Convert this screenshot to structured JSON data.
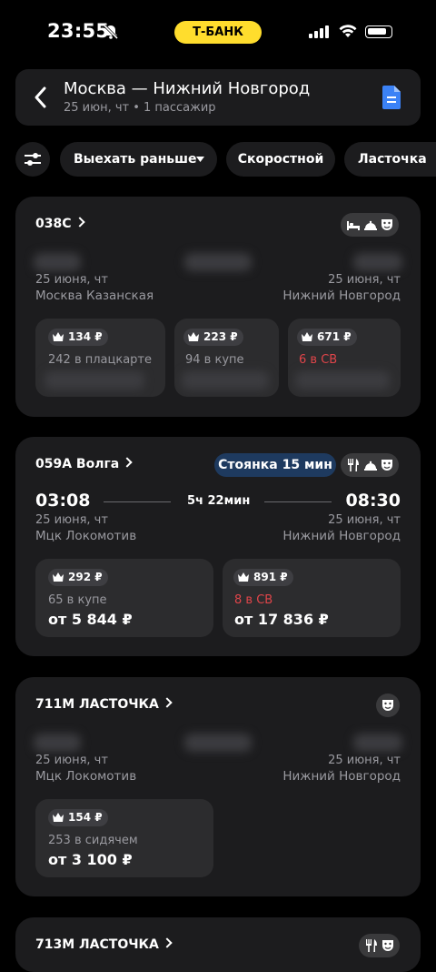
{
  "status_bar": {
    "time": "23:55",
    "bank": "Т-БАНК"
  },
  "header": {
    "route": "Москва — Нижний Новгород",
    "subtitle": "25 июн, чт • 1 пассажир"
  },
  "filters": [
    "Выехать раньше",
    "Скоростной",
    "Ласточка"
  ],
  "trains": [
    {
      "number": "038С",
      "dep_date": "25 июня, чт",
      "arr_date": "25 июня, чт",
      "dep_station": "Москва Казанская",
      "arr_station": "Нижний Новгород",
      "fares": [
        {
          "bonus": "134 ₽",
          "seats": "242 в плацкарте"
        },
        {
          "bonus": "223 ₽",
          "seats": "94 в купе"
        },
        {
          "bonus": "671 ₽",
          "seats": "6 в СВ"
        }
      ]
    },
    {
      "number": "059А Волга",
      "stop": "Стоянка 15 мин",
      "dep_time": "03:08",
      "duration": "5ч 22мин",
      "arr_time": "08:30",
      "dep_date": "25 июня, чт",
      "arr_date": "25 июня, чт",
      "dep_station": "Мцк Локомотив",
      "arr_station": "Нижний Новгород",
      "fares": [
        {
          "bonus": "292 ₽",
          "seats": "65 в купе",
          "price": "от 5 844 ₽"
        },
        {
          "bonus": "891 ₽",
          "seats": "8 в СВ",
          "price": "от 17 836 ₽"
        }
      ]
    },
    {
      "number": "711М ЛАСТОЧКА",
      "dep_date": "25 июня, чт",
      "arr_date": "25 июня, чт",
      "dep_station": "Мцк Локомотив",
      "arr_station": "Нижний Новгород",
      "fares": [
        {
          "bonus": "154 ₽",
          "seats": "253 в сидячем",
          "price": "от 3 100 ₽"
        }
      ]
    },
    {
      "number": "713М ЛАСТОЧКА"
    }
  ],
  "colors": {
    "accent": "#ffdd2d",
    "low_seats": "#e0454a",
    "stop_badge": "#1e3a5f",
    "doc_icon": "#3b82f6"
  }
}
